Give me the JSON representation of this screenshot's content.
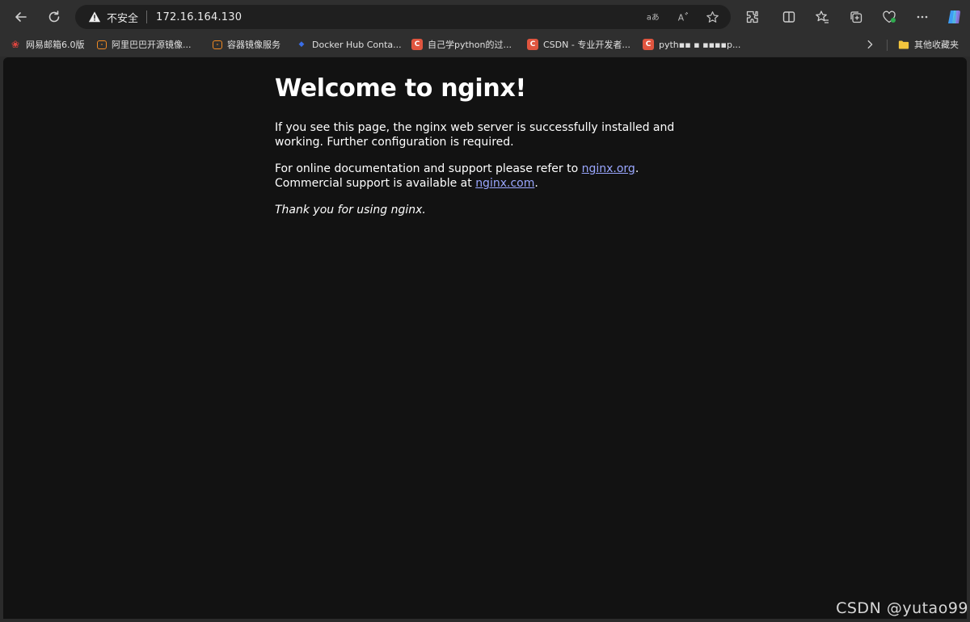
{
  "address_bar": {
    "security_label": "不安全",
    "url": "172.16.164.130"
  },
  "bookmarks": {
    "items": [
      {
        "label": "网易邮箱6.0版"
      },
      {
        "label": "阿里巴巴开源镜像..."
      },
      {
        "label": "容器镜像服务"
      },
      {
        "label": "Docker Hub Conta..."
      },
      {
        "label": "自己学python的过..."
      },
      {
        "label": "CSDN - 专业开发者..."
      },
      {
        "label": "pyth▪▪ ▪ ▪▪▪▪p..."
      }
    ],
    "other_folder": "其他收藏夹"
  },
  "page": {
    "heading": "Welcome to nginx!",
    "paragraph1": "If you see this page, the nginx web server is successfully installed and working. Further configuration is required.",
    "paragraph2_prefix": "For online documentation and support please refer to ",
    "link_org": "nginx.org",
    "paragraph2_mid": ".",
    "paragraph2_line2": "Commercial support is available at ",
    "link_com": "nginx.com",
    "paragraph2_end": ".",
    "paragraph3": "Thank you for using nginx."
  },
  "watermark": "CSDN @yutao99",
  "colors": {
    "link": "#9aa7ff",
    "page_background": "#121212",
    "chrome_background": "#2f2f2f"
  },
  "icons": [
    "back-arrow-icon",
    "refresh-icon",
    "warning-icon",
    "translate-icon",
    "read-aloud-icon",
    "favorite-star-icon",
    "extensions-icon",
    "split-screen-icon",
    "favorites-icon",
    "collections-icon",
    "browser-essentials-icon",
    "more-icon",
    "copilot-icon",
    "chevron-right-icon",
    "folder-icon"
  ]
}
